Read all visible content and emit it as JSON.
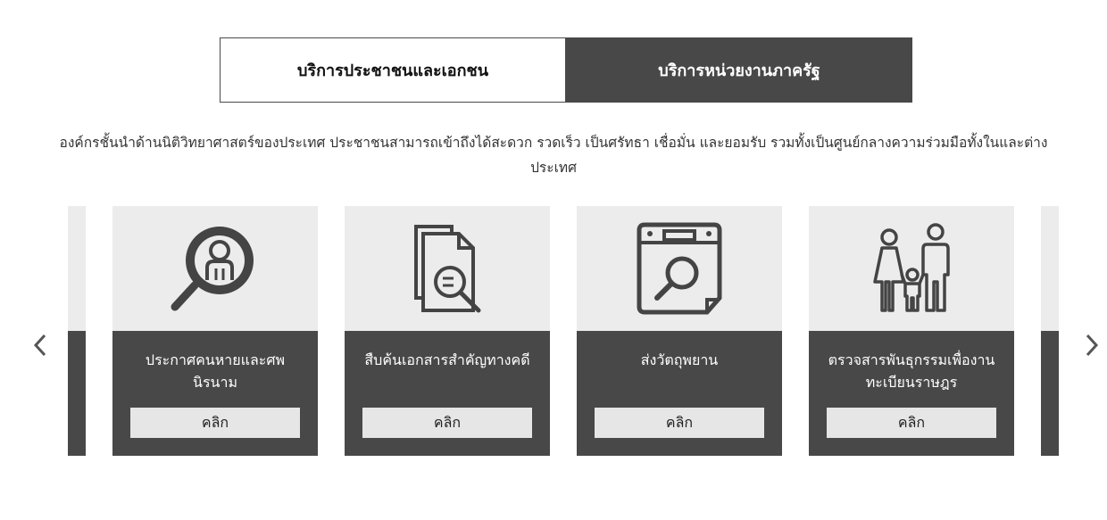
{
  "tabs": [
    {
      "label": "บริการประชาชนและเอกชน",
      "active": false
    },
    {
      "label": "บริการหน่วยงานภาครัฐ",
      "active": true
    }
  ],
  "description": "องค์กรชั้นนำด้านนิติวิทยาศาสตร์ของประเทศ ประชาชนสามารถเข้าถึงได้สะดวก รวดเร็ว เป็นศรัทธา เชื่อมั่น และยอมรับ รวมทั้งเป็นศูนย์กลางความร่วมมือทั้งในและต่างประเทศ",
  "carousel": {
    "prev_icon": "chevron-left-icon",
    "next_icon": "chevron-right-icon",
    "cards": [
      {
        "title": "ประกาศคนหายและศพนิรนาม",
        "button": "คลิก",
        "icon": "missing-person-search-icon"
      },
      {
        "title": "สืบค้นเอกสารสำคัญทางคดี",
        "button": "คลิก",
        "icon": "document-search-icon"
      },
      {
        "title": "ส่งวัตถุพยาน",
        "button": "คลิก",
        "icon": "evidence-box-search-icon"
      },
      {
        "title": "ตรวจสารพันธุกรรมเพื่องานทะเบียนราษฎร",
        "button": "คลิก",
        "icon": "family-icon"
      }
    ]
  },
  "colors": {
    "dark": "#484848",
    "light": "#ececec",
    "button": "#e6e6e6"
  }
}
